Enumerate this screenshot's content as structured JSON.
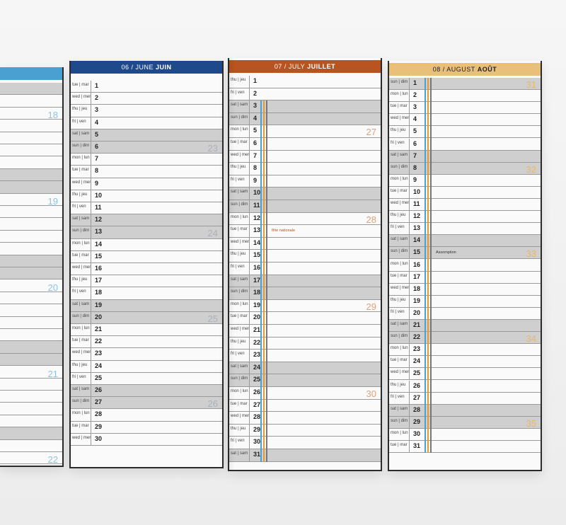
{
  "colors": {
    "june": "#1e4a8c",
    "july": "#b7541f",
    "august": "#e8c07a",
    "may": "#4aa0d0",
    "weekend": "#cfcfcf"
  },
  "panels": {
    "may": {
      "weeks": [
        "18",
        "19",
        "20",
        "21",
        "22"
      ]
    },
    "june": {
      "header_prefix": "06 / JUNE",
      "header_name": "JUIN",
      "days": [
        [
          "tue | mar",
          "1"
        ],
        [
          "wed | mer",
          "2"
        ],
        [
          "thu | jeu",
          "3"
        ],
        [
          "fri | ven",
          "4"
        ],
        [
          "sat | sam",
          "5"
        ],
        [
          "sun | dim",
          "6"
        ],
        [
          "mon | lun",
          "7"
        ],
        [
          "tue | mar",
          "8"
        ],
        [
          "wed | mer",
          "9"
        ],
        [
          "thu | jeu",
          "10"
        ],
        [
          "fri | ven",
          "11"
        ],
        [
          "sat | sam",
          "12"
        ],
        [
          "sun | dim",
          "13"
        ],
        [
          "mon | lun",
          "14"
        ],
        [
          "tue | mar",
          "15"
        ],
        [
          "wed | mer",
          "16"
        ],
        [
          "thu | jeu",
          "17"
        ],
        [
          "fri | ven",
          "18"
        ],
        [
          "sat | sam",
          "19"
        ],
        [
          "sun | dim",
          "20"
        ],
        [
          "mon | lun",
          "21"
        ],
        [
          "tue | mar",
          "22"
        ],
        [
          "wed | mer",
          "23"
        ],
        [
          "thu | jeu",
          "24"
        ],
        [
          "fri | ven",
          "25"
        ],
        [
          "sat | sam",
          "26"
        ],
        [
          "sun | dim",
          "27"
        ],
        [
          "mon | lun",
          "28"
        ],
        [
          "tue | mar",
          "29"
        ],
        [
          "wed | mer",
          "30"
        ]
      ],
      "weeks": [
        "23",
        "24",
        "25",
        "26"
      ]
    },
    "july": {
      "header_prefix": "07 / JULY",
      "header_name": "JUILLET",
      "days": [
        [
          "thu | jeu",
          "1"
        ],
        [
          "fri | ven",
          "2"
        ],
        [
          "sat | sam",
          "3"
        ],
        [
          "sun | dim",
          "4"
        ],
        [
          "mon | lun",
          "5"
        ],
        [
          "tue | mar",
          "6"
        ],
        [
          "wed | mer",
          "7"
        ],
        [
          "thu | jeu",
          "8"
        ],
        [
          "fri | ven",
          "9"
        ],
        [
          "sat | sam",
          "10"
        ],
        [
          "sun | dim",
          "11"
        ],
        [
          "mon | lun",
          "12"
        ],
        [
          "tue | mar",
          "13"
        ],
        [
          "wed | mer",
          "14"
        ],
        [
          "thu | jeu",
          "15"
        ],
        [
          "fri | ven",
          "16"
        ],
        [
          "sat | sam",
          "17"
        ],
        [
          "sun | dim",
          "18"
        ],
        [
          "mon | lun",
          "19"
        ],
        [
          "tue | mar",
          "20"
        ],
        [
          "wed | mer",
          "21"
        ],
        [
          "thu | jeu",
          "22"
        ],
        [
          "fri | ven",
          "23"
        ],
        [
          "sat | sam",
          "24"
        ],
        [
          "sun | dim",
          "25"
        ],
        [
          "mon | lun",
          "26"
        ],
        [
          "tue | mar",
          "27"
        ],
        [
          "wed | mer",
          "28"
        ],
        [
          "thu | jeu",
          "29"
        ],
        [
          "fri | ven",
          "30"
        ],
        [
          "sat | sam",
          "31"
        ]
      ],
      "weeks": [
        "27",
        "28",
        "29",
        "30"
      ],
      "note": "fête nationale"
    },
    "august": {
      "header_prefix": "08 / AUGUST",
      "header_name": "AOÛT",
      "days": [
        [
          "sun | dim",
          "1"
        ],
        [
          "mon | lun",
          "2"
        ],
        [
          "tue | mar",
          "3"
        ],
        [
          "wed | mer",
          "4"
        ],
        [
          "thu | jeu",
          "5"
        ],
        [
          "fri | ven",
          "6"
        ],
        [
          "sat | sam",
          "7"
        ],
        [
          "sun | dim",
          "8"
        ],
        [
          "mon | lun",
          "9"
        ],
        [
          "tue | mar",
          "10"
        ],
        [
          "wed | mer",
          "11"
        ],
        [
          "thu | jeu",
          "12"
        ],
        [
          "fri | ven",
          "13"
        ],
        [
          "sat | sam",
          "14"
        ],
        [
          "sun | dim",
          "15"
        ],
        [
          "mon | lun",
          "16"
        ],
        [
          "tue | mar",
          "17"
        ],
        [
          "wed | mer",
          "18"
        ],
        [
          "thu | jeu",
          "19"
        ],
        [
          "fri | ven",
          "20"
        ],
        [
          "sat | sam",
          "21"
        ],
        [
          "sun | dim",
          "22"
        ],
        [
          "mon | lun",
          "23"
        ],
        [
          "tue | mar",
          "24"
        ],
        [
          "wed | mer",
          "25"
        ],
        [
          "thu | jeu",
          "26"
        ],
        [
          "fri | ven",
          "27"
        ],
        [
          "sat | sam",
          "28"
        ],
        [
          "sun | dim",
          "29"
        ],
        [
          "mon | lun",
          "30"
        ],
        [
          "tue | mar",
          "31"
        ]
      ],
      "weeks": [
        "31",
        "32",
        "33",
        "34",
        "35"
      ],
      "note": "Assomption"
    }
  }
}
